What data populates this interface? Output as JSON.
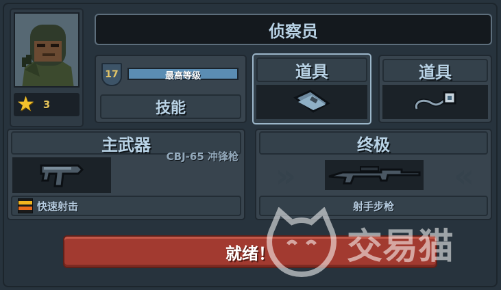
{
  "character": {
    "name": "侦察员",
    "stars": "3",
    "level": "17",
    "level_label": "最高等级",
    "skill_label": "技能"
  },
  "items": [
    {
      "label": "道具",
      "icon": "ammo-clip-icon"
    },
    {
      "label": "道具",
      "icon": "grapple-hook-icon"
    }
  ],
  "primary": {
    "title": "主武器",
    "weapon_name": "CBJ-65 冲锋枪",
    "perk": "快速射击",
    "icon": "smg-icon"
  },
  "ultimate": {
    "title": "终极",
    "weapon_name": "射手步枪",
    "icon": "sniper-rifle-icon"
  },
  "ready_button": "就绪！",
  "watermark": "交易猫"
}
